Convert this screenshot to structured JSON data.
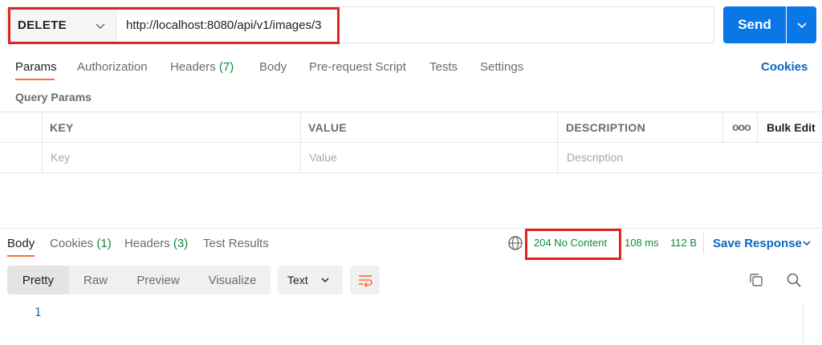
{
  "request": {
    "method": "DELETE",
    "url": "http://localhost:8080/api/v1/images/3",
    "send_label": "Send"
  },
  "request_tabs": {
    "params": "Params",
    "authorization": "Authorization",
    "headers": "Headers",
    "headers_count": "(7)",
    "body": "Body",
    "pre_request": "Pre-request Script",
    "tests": "Tests",
    "settings": "Settings",
    "cookies": "Cookies"
  },
  "query_params": {
    "title": "Query Params",
    "columns": {
      "key": "KEY",
      "value": "VALUE",
      "description": "DESCRIPTION"
    },
    "bulk_edit": "Bulk Edit",
    "more": "ooo",
    "placeholders": {
      "key": "Key",
      "value": "Value",
      "description": "Description"
    }
  },
  "response": {
    "tabs": {
      "body": "Body",
      "cookies": "Cookies",
      "cookies_count": "(1)",
      "headers": "Headers",
      "headers_count": "(3)",
      "test_results": "Test Results"
    },
    "status": "204 No Content",
    "time": "108 ms",
    "size": "112 B",
    "save_response": "Save Response",
    "views": [
      "Pretty",
      "Raw",
      "Preview",
      "Visualize"
    ],
    "format": "Text",
    "line_number": "1"
  },
  "colors": {
    "accent": "#0a77e8",
    "link": "#0a66c2",
    "success": "#0c8a3c",
    "tab_underline": "#ff6c37",
    "highlight": "#e02424"
  },
  "icons": [
    "chevron-down-icon",
    "globe-icon",
    "wrap-lines-icon",
    "copy-icon",
    "search-icon"
  ]
}
